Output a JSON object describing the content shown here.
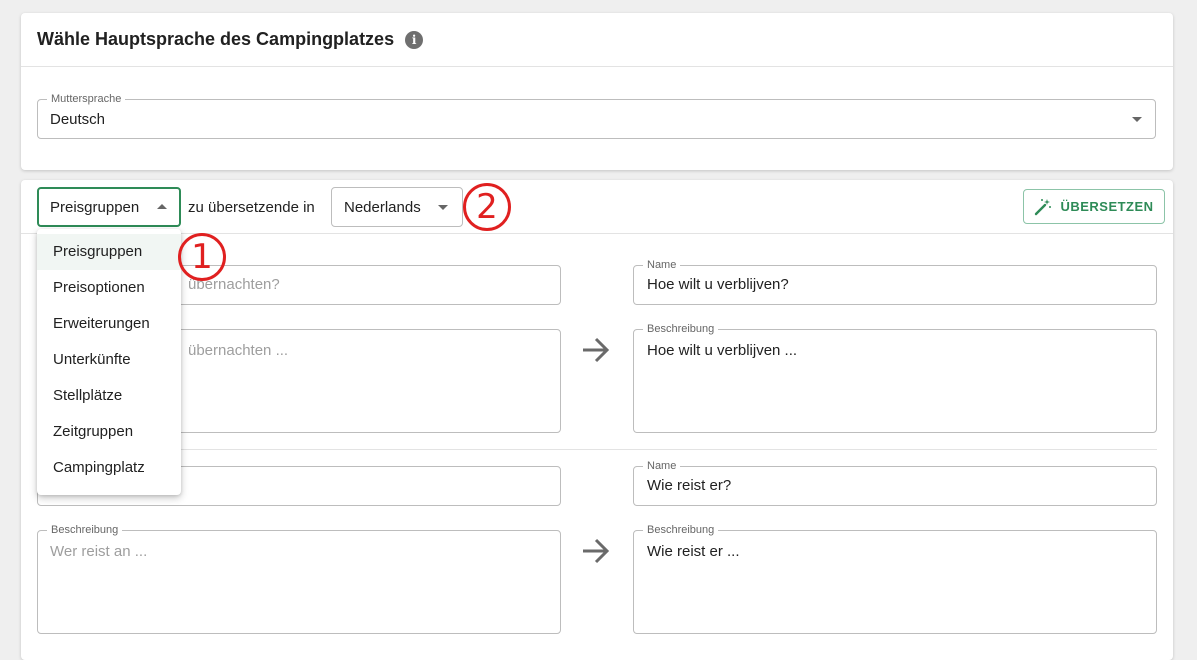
{
  "language_card": {
    "title": "Wähle Hauptsprache des Campingplatzes",
    "info_icon": "info-icon",
    "native_language": {
      "label": "Muttersprache",
      "value": "Deutsch"
    }
  },
  "translate_card": {
    "category_select": {
      "value": "Preisgruppen"
    },
    "connector_text": "zu übersetzende in",
    "target_language_select": {
      "value": "Nederlands"
    },
    "translate_button": {
      "label": "ÜBERSETZEN",
      "icon": "magic-wand-icon"
    },
    "rows": [
      {
        "source": {
          "name_value": "übernachten?",
          "description_value": "übernachten ..."
        },
        "target": {
          "name_label": "Name",
          "name_value": "Hoe wilt u verblijven?",
          "description_label": "Beschreibung",
          "description_value": "Hoe wilt u verblijven ..."
        }
      },
      {
        "source": {
          "name_value": "",
          "description_label": "Beschreibung",
          "description_value": "Wer reist an ..."
        },
        "target": {
          "name_label": "Name",
          "name_value": "Wie reist er?",
          "description_label": "Beschreibung",
          "description_value": "Wie reist er ..."
        }
      }
    ]
  },
  "category_menu": {
    "items": [
      "Preisgruppen",
      "Preisoptionen",
      "Erweiterungen",
      "Unterkünfte",
      "Stellplätze",
      "Zeitgruppen",
      "Campingplatz"
    ],
    "selected": "Preisgruppen"
  },
  "annotations": {
    "one": "1",
    "two": "2",
    "color": "#e02020"
  },
  "colors": {
    "accent_green": "#2e8b57",
    "annotation_red": "#e02020"
  }
}
